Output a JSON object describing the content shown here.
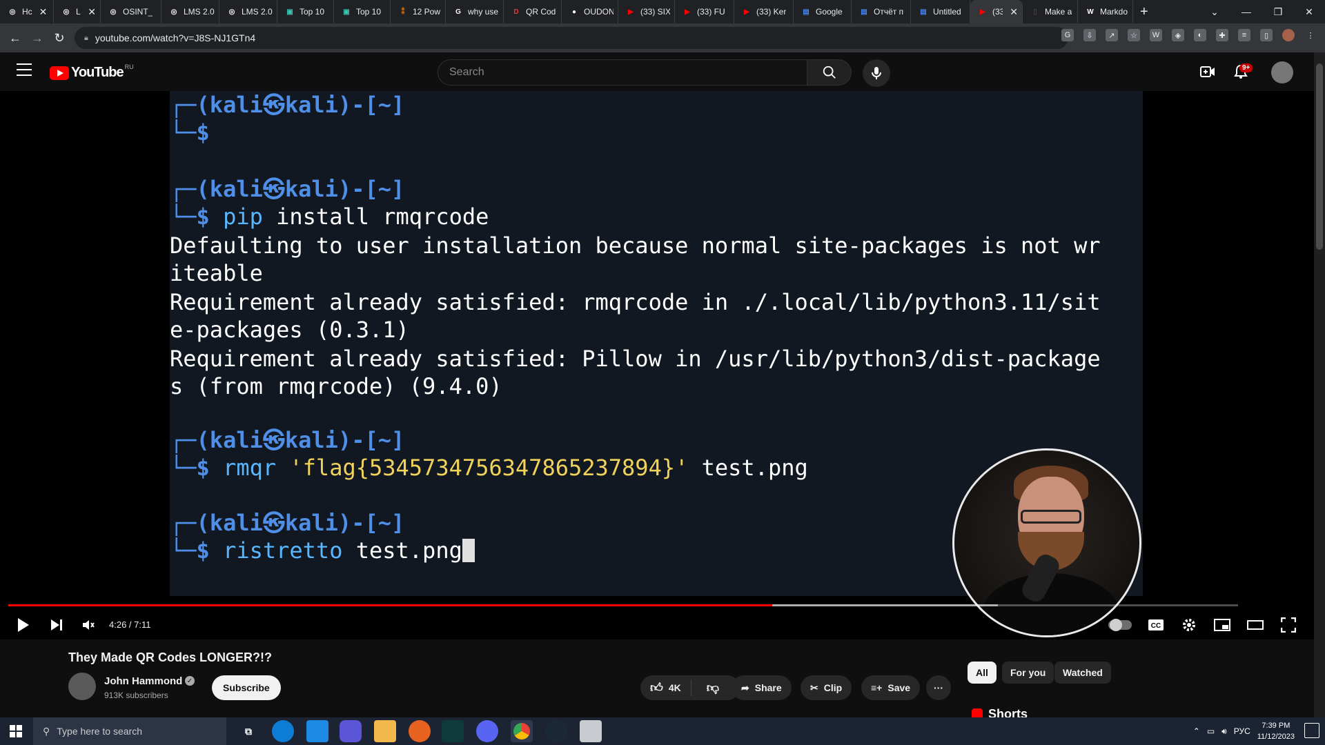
{
  "browser": {
    "tabs": [
      {
        "label": "Hc",
        "fav_color": "#ffffff",
        "fav_text": "◎"
      },
      {
        "label": "LM",
        "fav_color": "#ffffff",
        "fav_text": "◎"
      },
      {
        "label": "OSINT_",
        "fav_color": "#ffffff",
        "fav_text": "◎"
      },
      {
        "label": "LMS 2.0",
        "fav_color": "#ffffff",
        "fav_text": "◎"
      },
      {
        "label": "LMS 2.0",
        "fav_color": "#ffffff",
        "fav_text": "◎"
      },
      {
        "label": "Top 10",
        "fav_color": "#39c6b3",
        "fav_text": "▣"
      },
      {
        "label": "Top 10",
        "fav_color": "#39c6b3",
        "fav_text": "▣"
      },
      {
        "label": "12 Pow",
        "fav_color": "#e8710a",
        "fav_text": "⁑"
      },
      {
        "label": "why use",
        "fav_color": "#ffffff",
        "fav_text": "G"
      },
      {
        "label": "QR Cod",
        "fav_color": "#e53935",
        "fav_text": "D"
      },
      {
        "label": "OUDON",
        "fav_color": "#ffffff",
        "fav_text": "●"
      },
      {
        "label": "(33) SIX",
        "fav_color": "#ff0000",
        "fav_text": "▶"
      },
      {
        "label": "(33) FU",
        "fav_color": "#ff0000",
        "fav_text": "▶"
      },
      {
        "label": "(33) Ker",
        "fav_color": "#ff0000",
        "fav_text": "▶"
      },
      {
        "label": "Google",
        "fav_color": "#4285f4",
        "fav_text": "▤"
      },
      {
        "label": "Отчёт п",
        "fav_color": "#4285f4",
        "fav_text": "▤"
      },
      {
        "label": "Untitled",
        "fav_color": "#4285f4",
        "fav_text": "▤"
      },
      {
        "label": "(33",
        "fav_color": "#ff0000",
        "fav_text": "▶"
      },
      {
        "label": "Make a",
        "fav_color": "#444444",
        "fav_text": "▯"
      },
      {
        "label": "Markdo",
        "fav_color": "#ffffff",
        "fav_text": "W"
      }
    ],
    "new_tab": "+",
    "url": "youtube.com/watch?v=J8S-NJ1GTn4"
  },
  "youtube": {
    "logo_text": "YouTube",
    "region": "RU",
    "search_placeholder": "Search",
    "notification_count": "9+"
  },
  "video": {
    "terminal_lines": [
      {
        "type": "prompt",
        "text": "┌─(kali㉿kali)-[~]"
      },
      {
        "type": "cmd",
        "dollar": "└─$",
        "cmd": ""
      },
      {
        "type": "prompt",
        "text": "┌─(kali㉿kali)-[~]"
      },
      {
        "type": "cmd",
        "dollar": "└─$",
        "cmd_blue": "pip",
        "cmd": " install rmqrcode"
      },
      {
        "type": "out",
        "text": "Defaulting to user installation because normal site-packages is not wr"
      },
      {
        "type": "out",
        "text": "iteable"
      },
      {
        "type": "out",
        "text": "Requirement already satisfied: rmqrcode in ./.local/lib/python3.11/sit"
      },
      {
        "type": "out",
        "text": "e-packages (0.3.1)"
      },
      {
        "type": "out",
        "text": "Requirement already satisfied: Pillow in /usr/lib/python3/dist-package"
      },
      {
        "type": "out",
        "text": "s (from rmqrcode) (9.4.0)"
      },
      {
        "type": "prompt",
        "text": "┌─(kali㉿kali)-[~]"
      },
      {
        "type": "cmd",
        "dollar": "└─$",
        "cmd_blue": "rmqr",
        "flag": " 'flag{53457347563478652378​94}'",
        "cmd": " test.png"
      },
      {
        "type": "prompt",
        "text": "┌─(kali㉿kali)-[~]"
      },
      {
        "type": "cmd",
        "dollar": "└─$",
        "cmd_blue": "ristretto",
        "cmd": " test.png"
      }
    ],
    "time": "4:26 / 7:11",
    "progress_fraction": 0.621,
    "loaded_fraction": 0.805,
    "title": "They Made QR Codes LONGER?!?",
    "channel": "John Hammond",
    "subscribers": "913K subscribers",
    "subscribe_label": "Subscribe",
    "likes": "4K",
    "share_label": "Share",
    "clip_label": "Clip",
    "save_label": "Save",
    "more_label": "···"
  },
  "chips": [
    "All",
    "For you",
    "Watched"
  ],
  "shorts_label": "Shorts",
  "taskbar": {
    "search_placeholder": "Type here to search",
    "language": "РУС",
    "time": "7:39 PM",
    "date": "11/12/2023"
  }
}
